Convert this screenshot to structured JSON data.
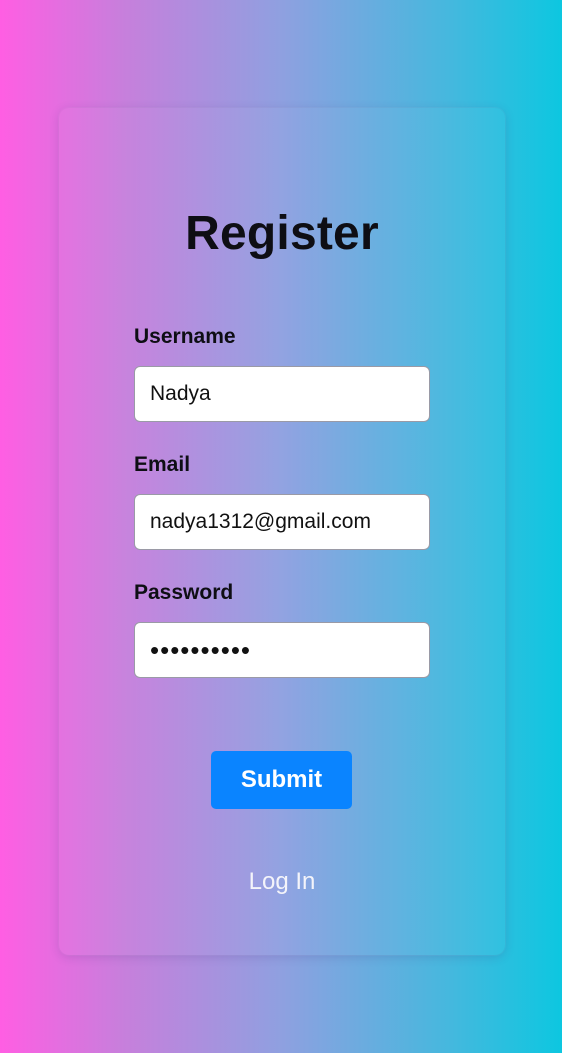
{
  "form": {
    "title": "Register",
    "username": {
      "label": "Username",
      "value": "Nadya"
    },
    "email": {
      "label": "Email",
      "value": "nadya1312@gmail.com"
    },
    "password": {
      "label": "Password",
      "value": "••••••••••"
    },
    "submit_label": "Submit",
    "login_link": "Log In"
  },
  "colors": {
    "gradient_left": "#ff5ee3",
    "gradient_right": "#0dc7e0",
    "submit_button": "#0a84ff"
  }
}
